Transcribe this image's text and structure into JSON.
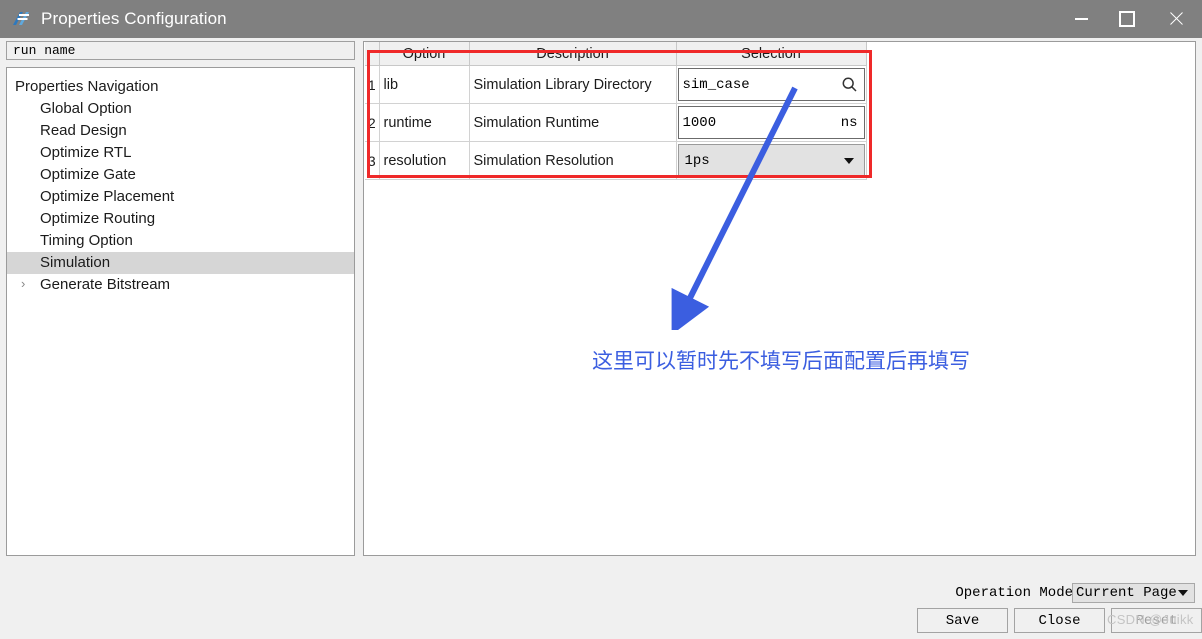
{
  "window": {
    "title": "Properties Configuration",
    "icon": "app-logo-icon",
    "minimize": "minimize-icon",
    "maximize": "maximize-icon",
    "close": "close-icon"
  },
  "left_panel": {
    "run_name_label": "run name",
    "nav_root": "Properties Navigation",
    "nav_items": [
      {
        "label": "Global Option",
        "selected": false,
        "expandable": false
      },
      {
        "label": "Read Design",
        "selected": false,
        "expandable": false
      },
      {
        "label": "Optimize RTL",
        "selected": false,
        "expandable": false
      },
      {
        "label": "Optimize Gate",
        "selected": false,
        "expandable": false
      },
      {
        "label": "Optimize Placement",
        "selected": false,
        "expandable": false
      },
      {
        "label": "Optimize Routing",
        "selected": false,
        "expandable": false
      },
      {
        "label": "Timing Option",
        "selected": false,
        "expandable": false
      },
      {
        "label": "Simulation",
        "selected": true,
        "expandable": false
      },
      {
        "label": "Generate Bitstream",
        "selected": false,
        "expandable": true
      }
    ],
    "expand_glyph": "›"
  },
  "table": {
    "headers": {
      "num": "",
      "option": "Option",
      "description": "Description",
      "selection": "Selection"
    },
    "rows": [
      {
        "num": "1",
        "option": "lib",
        "description": "Simulation Library Directory",
        "selection_value": "sim_case",
        "selection_type": "text-with-search",
        "search_icon": "search-icon",
        "suffix": ""
      },
      {
        "num": "2",
        "option": "runtime",
        "description": "Simulation Runtime",
        "selection_value": "1000",
        "selection_type": "text-with-unit",
        "suffix": "ns"
      },
      {
        "num": "3",
        "option": "resolution",
        "description": "Simulation Resolution",
        "selection_value": "1ps",
        "selection_type": "dropdown",
        "suffix": ""
      }
    ]
  },
  "annotations": {
    "highlight_box_color": "#ef2929",
    "arrow_color": "#3b5ee0",
    "note_text": "这里可以暂时先不填写后面配置后再填写",
    "note_color": "#3b5ee0",
    "watermark": "CSDN @Juikk"
  },
  "footer": {
    "operation_mode_label": "Operation Mode",
    "operation_mode_value": "Current Page",
    "buttons": [
      {
        "label": "Save",
        "disabled": false
      },
      {
        "label": "Close",
        "disabled": false
      },
      {
        "label": "Reset",
        "disabled": true
      }
    ]
  }
}
